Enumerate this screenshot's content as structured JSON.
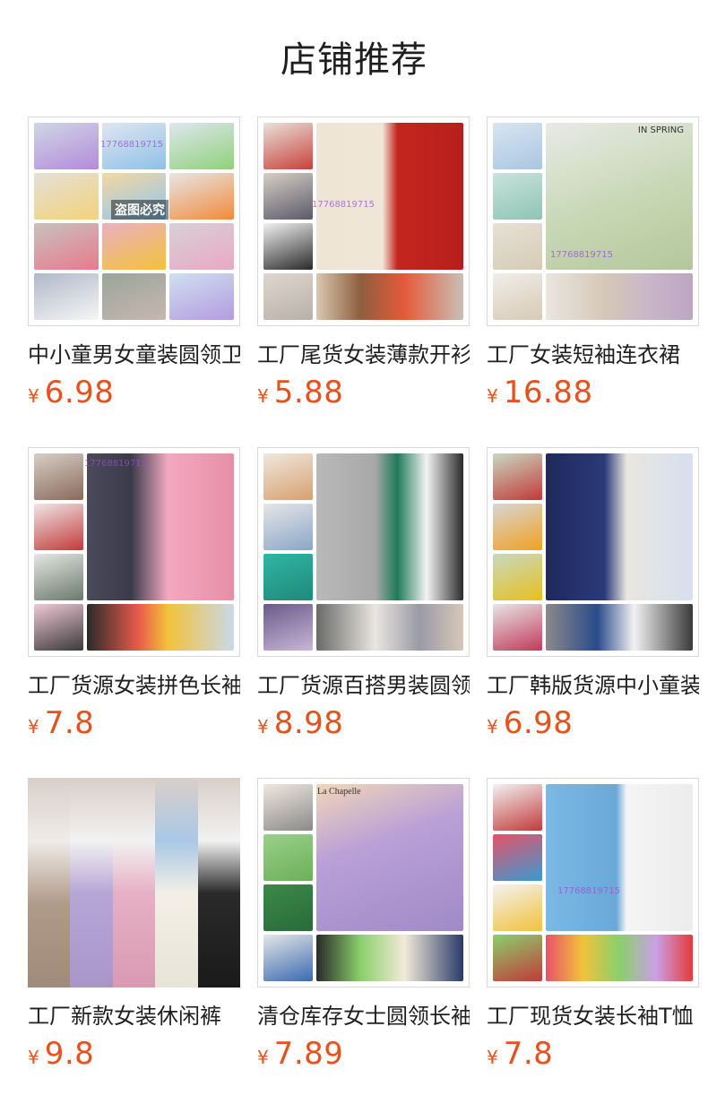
{
  "header": {
    "title": "店铺推荐"
  },
  "products": [
    {
      "title": "中小童男女童装圆领卫衣",
      "currency": "¥",
      "price": "6.98",
      "watermark": "17768819715",
      "badge": "盗图必究"
    },
    {
      "title": "工厂尾货女装薄款开衫",
      "currency": "¥",
      "price": "5.88",
      "watermark": "17768819715",
      "badge": ""
    },
    {
      "title": "工厂女装短袖连衣裙",
      "currency": "¥",
      "price": "16.88",
      "watermark": "17768819715",
      "badge": "IN SPRING"
    },
    {
      "title": "工厂货源女装拼色长袖",
      "currency": "¥",
      "price": "7.8",
      "watermark": "17768819715",
      "badge": ""
    },
    {
      "title": "工厂货源百搭男装圆领",
      "currency": "¥",
      "price": "8.98",
      "watermark": "",
      "badge": ""
    },
    {
      "title": "工厂韩版货源中小童装",
      "currency": "¥",
      "price": "6.98",
      "watermark": "",
      "badge": ""
    },
    {
      "title": "工厂新款女装休闲裤",
      "currency": "¥",
      "price": "9.8",
      "watermark": "",
      "badge": ""
    },
    {
      "title": "清仓库存女士圆领长袖",
      "currency": "¥",
      "price": "7.89",
      "watermark": "",
      "badge": "La Chapelle"
    },
    {
      "title": "工厂现货女装长袖T恤",
      "currency": "¥",
      "price": "7.8",
      "watermark": "17768819715",
      "badge": ""
    }
  ],
  "colors": {
    "price": "#e8501c",
    "title_text": "#1f1f1f",
    "border": "#d9d9d9",
    "watermark": "#9650d2"
  },
  "icons": {
    "currency": "yuan-sign"
  }
}
